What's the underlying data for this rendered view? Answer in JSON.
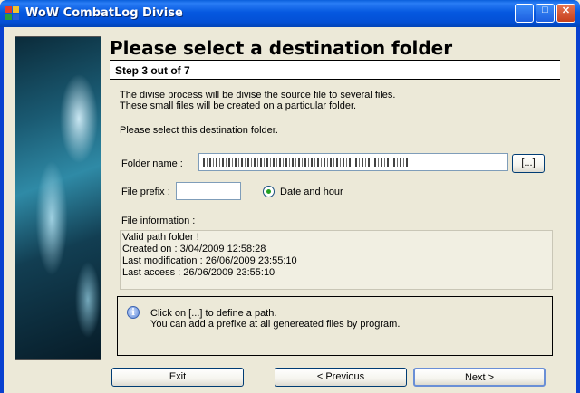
{
  "window": {
    "title": "WoW CombatLog Divise",
    "controls": {
      "minimize": "_",
      "maximize": "□",
      "close": "✕"
    }
  },
  "wizard": {
    "heading": "Please select a destination folder",
    "step": "Step 3 out of 7",
    "description_line1": "The divise process will be divise the source file to several files.",
    "description_line2": "These small files will be created on a particular folder.",
    "instruction": "Please select this destination folder."
  },
  "form": {
    "folder_label": "Folder name :",
    "folder_value": "",
    "browse_label": "[...]",
    "prefix_label": "File prefix :",
    "prefix_value": "",
    "date_option_label": "Date and hour",
    "date_option_selected": true
  },
  "file_info": {
    "label": "File information :",
    "lines": [
      "Valid path folder !",
      "Created on : 3/04/2009 12:58:28",
      "Last modification : 26/06/2009 23:55:10",
      "Last access : 26/06/2009 23:55:10"
    ]
  },
  "hint": {
    "icon": "info-icon",
    "line1": "Click on [...] to define a path.",
    "line2": "You can add a prefixe at all genereated files by program."
  },
  "buttons": {
    "exit": "Exit",
    "previous": "< Previous",
    "next": "Next >"
  },
  "colors": {
    "titlebar": "#0558e0",
    "window_bg": "#ece9d8",
    "radio_dot": "#21a121"
  }
}
